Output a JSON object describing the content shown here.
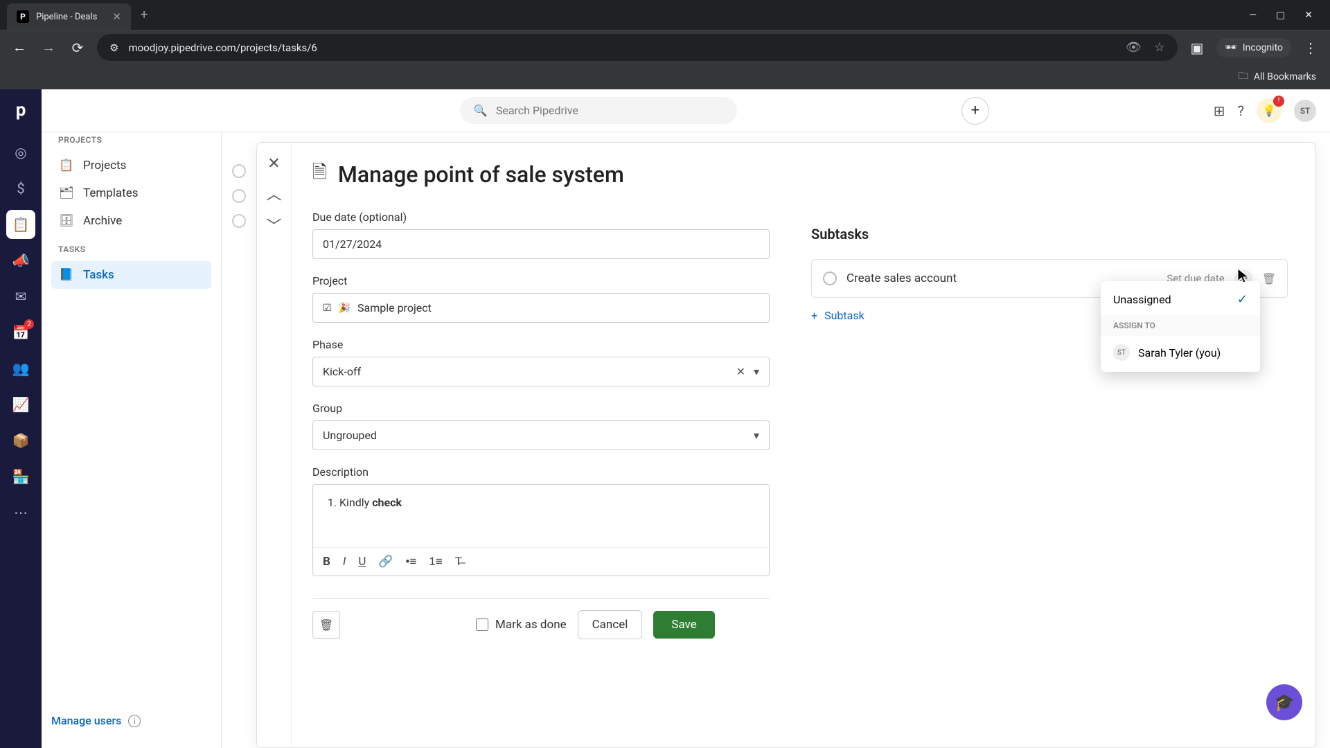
{
  "browser": {
    "tab_title": "Pipeline - Deals",
    "url": "moodjoy.pipedrive.com/projects/tasks/6",
    "incognito_label": "Incognito",
    "bookmarks_label": "All Bookmarks"
  },
  "topbar": {
    "search_placeholder": "Search Pipedrive",
    "avatar_initials": "ST"
  },
  "rail": {
    "badge": "2"
  },
  "breadcrumb": {
    "parent": "Projects",
    "current": "Tasks"
  },
  "sidebar": {
    "section_projects": "PROJECTS",
    "items_projects": [
      "Projects",
      "Templates",
      "Archive"
    ],
    "section_tasks": "TASKS",
    "items_tasks": [
      "Tasks"
    ],
    "manage_users": "Manage users"
  },
  "task": {
    "title": "Manage point of sale system",
    "due_label": "Due date (optional)",
    "due_value": "01/27/2024",
    "project_label": "Project",
    "project_value": "Sample project",
    "phase_label": "Phase",
    "phase_value": "Kick-off",
    "group_label": "Group",
    "group_value": "Ungrouped",
    "desc_label": "Description",
    "desc_prefix": "Kindly ",
    "desc_bold": "check",
    "mark_done": "Mark as done",
    "cancel": "Cancel",
    "save": "Save"
  },
  "subtasks": {
    "heading": "Subtasks",
    "item_name": "Create sales account",
    "set_due": "Set due date",
    "add_label": "Subtask"
  },
  "assign_dd": {
    "unassigned": "Unassigned",
    "header": "ASSIGN TO",
    "user_initials": "ST",
    "user_name": "Sarah Tyler (you)"
  }
}
